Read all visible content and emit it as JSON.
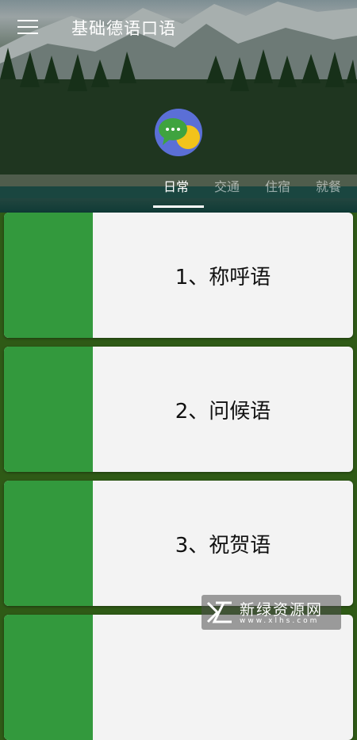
{
  "app": {
    "title": "基础德语口语"
  },
  "tabs": [
    {
      "label": "日常",
      "active": true
    },
    {
      "label": "交通",
      "active": false
    },
    {
      "label": "住宿",
      "active": false
    },
    {
      "label": "就餐",
      "active": false
    }
  ],
  "cards": [
    {
      "label": "1、称呼语"
    },
    {
      "label": "2、问候语"
    },
    {
      "label": "3、祝贺语"
    },
    {
      "label": ""
    }
  ],
  "colors": {
    "accent": "#33993d",
    "background": "#2f5a16",
    "avatar": "#5b6fd6"
  },
  "watermark": {
    "text": "新绿资源网",
    "sub": "www.xlhs.com"
  }
}
